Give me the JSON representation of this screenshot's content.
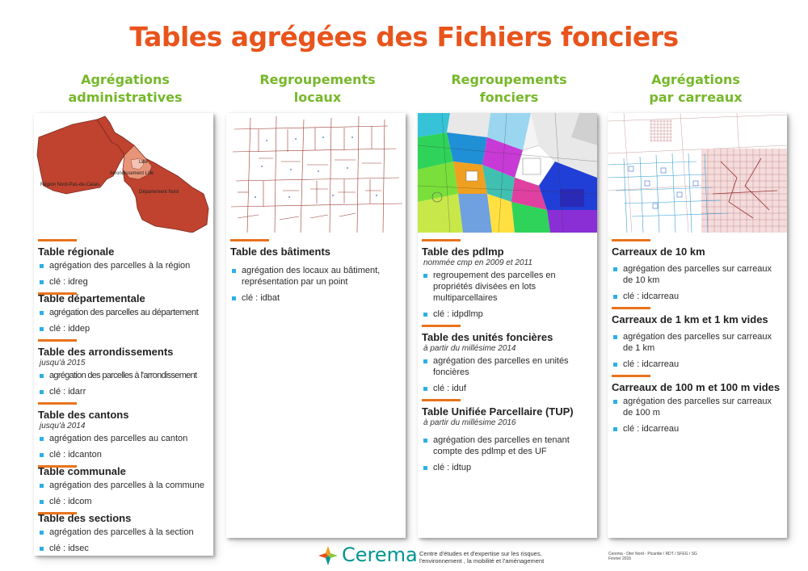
{
  "title": "Tables agrégées des Fichiers fonciers",
  "columns": [
    {
      "head": [
        "Agrégations",
        "administratives"
      ],
      "map_labels": {
        "lille": "Lille",
        "arrondissement": "Arrondissement Lille",
        "region": "Région Nord-Pas-de-Calais",
        "departement": "Département Nord"
      },
      "sections": [
        {
          "title": "Table régionale",
          "subtitle": "",
          "items": [
            "agrégation des parcelles à la région",
            "clé : idreg"
          ]
        },
        {
          "title": "Table départementale",
          "subtitle": "",
          "items": [
            "agrégation des parcelles au département",
            "clé : iddep"
          ]
        },
        {
          "title": "Table des arrondissements",
          "subtitle": "jusqu'à 2015",
          "items": [
            "agrégation des parcelles à l'arrondissement",
            "clé : idarr"
          ]
        },
        {
          "title": "Table des cantons",
          "subtitle": "jusqu'à 2014",
          "items": [
            "agrégation des parcelles au canton",
            "clé : idcanton"
          ]
        },
        {
          "title": "Table communale",
          "subtitle": "",
          "items": [
            "agrégation des parcelles à la commune",
            "clé : idcom"
          ]
        },
        {
          "title": "Table des sections",
          "subtitle": "",
          "items": [
            "agrégation des parcelles à la section",
            "clé : idsec"
          ]
        }
      ]
    },
    {
      "head": [
        "Regroupements",
        "locaux"
      ],
      "sections": [
        {
          "title": "Table des bâtiments",
          "subtitle": "",
          "items": [
            "agrégation des locaux au bâtiment, représentation par un point",
            "clé : idbat"
          ]
        }
      ]
    },
    {
      "head": [
        "Regroupements",
        "fonciers"
      ],
      "sections": [
        {
          "title": "Table des pdlmp",
          "subtitle": "nommée cmp en 2009 et 2011",
          "items": [
            "regroupement des parcelles en propriétés divisées en lots multiparcellaires",
            "clé : idpdlmp"
          ]
        },
        {
          "title": "Table des unités foncières",
          "subtitle": "à partir du millésime 2014",
          "items": [
            "agrégation des parcelles en unités foncières",
            "clé : iduf"
          ]
        },
        {
          "title": "Table Unifiée Parcellaire (TUP)",
          "subtitle": "à partir du millésime 2016",
          "items": [
            "agrégation des parcelles en tenant compte des pdlmp et des UF",
            "clé : idtup"
          ]
        }
      ]
    },
    {
      "head": [
        "Agrégations",
        "par carreaux"
      ],
      "sections": [
        {
          "title": "Carreaux de 10 km",
          "subtitle": "",
          "items": [
            "agrégation des parcelles sur carreaux de 10 km",
            "clé : idcarreau"
          ]
        },
        {
          "title": "Carreaux de 1 km et 1 km vides",
          "subtitle": "",
          "items": [
            "agrégation des parcelles sur carreaux de 1 km",
            "clé : idcarreau"
          ]
        },
        {
          "title": "Carreaux de 100 m et 100 m vides",
          "subtitle": "",
          "items": [
            "agrégation des parcelles sur carreaux de 100 m",
            "clé : idcarreau"
          ]
        }
      ]
    }
  ],
  "footer": {
    "logo": "Cerema",
    "description": "Centre d'études et d'expertise sur les risques, l'environnement , la mobilité et l'aménagement",
    "credit": [
      "Cerema - Dter Nord - Picardie / RDT / SFEG / SG",
      "Février 2016"
    ]
  },
  "colors": {
    "title": "#e8541c",
    "heading": "#76b82a",
    "rule": "#e8731c",
    "bullet": "#2eb0e4",
    "logo": "#00958f"
  }
}
